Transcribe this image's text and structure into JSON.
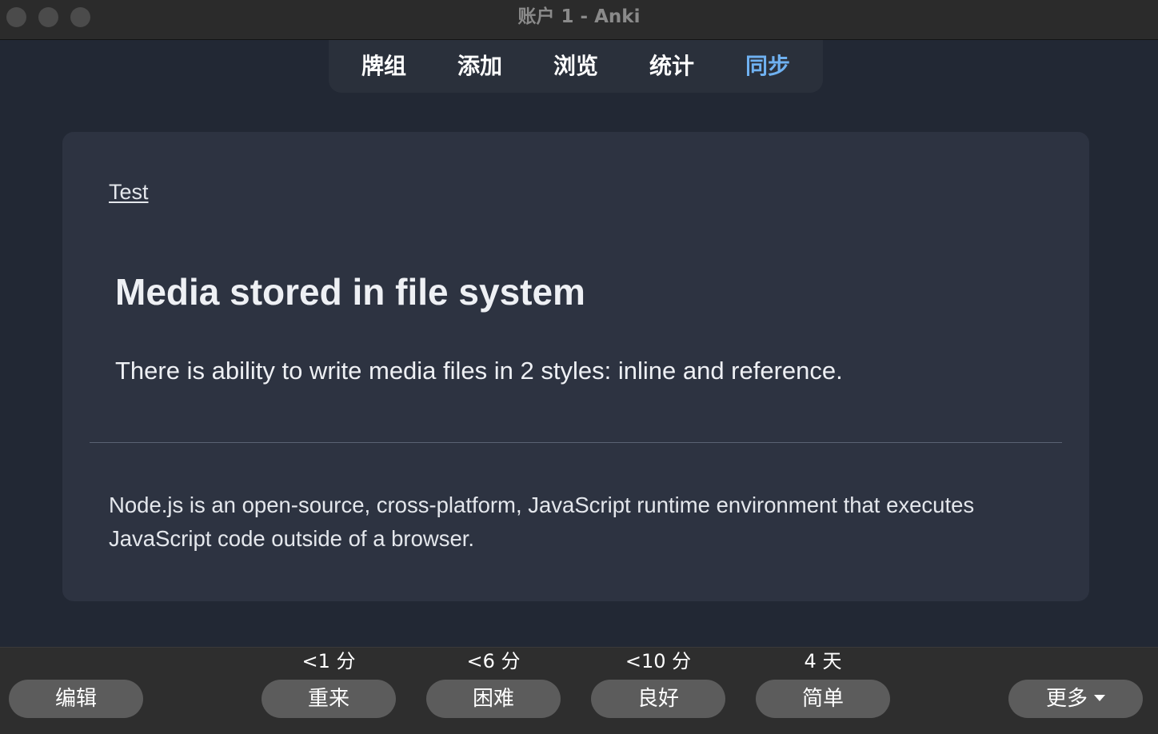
{
  "window": {
    "title": "账户 1 - Anki"
  },
  "nav": {
    "items": [
      {
        "label": "牌组"
      },
      {
        "label": "添加"
      },
      {
        "label": "浏览"
      },
      {
        "label": "统计"
      },
      {
        "label": "同步"
      }
    ],
    "active_index": 4
  },
  "card": {
    "deck_link": "Test",
    "heading": "Media stored in file system",
    "paragraph": "There is ability to write media files in 2 styles: inline and reference.",
    "answer": "Node.js is an open-source, cross-platform, JavaScript runtime environment that executes JavaScript code outside of a browser."
  },
  "bottom": {
    "edit_label": "编辑",
    "more_label": "更多",
    "answers": [
      {
        "interval": "<1 分",
        "label": "重来"
      },
      {
        "interval": "<6 分",
        "label": "困难"
      },
      {
        "interval": "<10 分",
        "label": "良好"
      },
      {
        "interval": "4 天",
        "label": "简单"
      }
    ]
  },
  "colors": {
    "background": "#222834",
    "card": "#2d3341",
    "active_nav": "#6fb1f1",
    "button": "#5c5c5c"
  },
  "icons": {
    "more_dropdown": "caret-down-icon"
  }
}
